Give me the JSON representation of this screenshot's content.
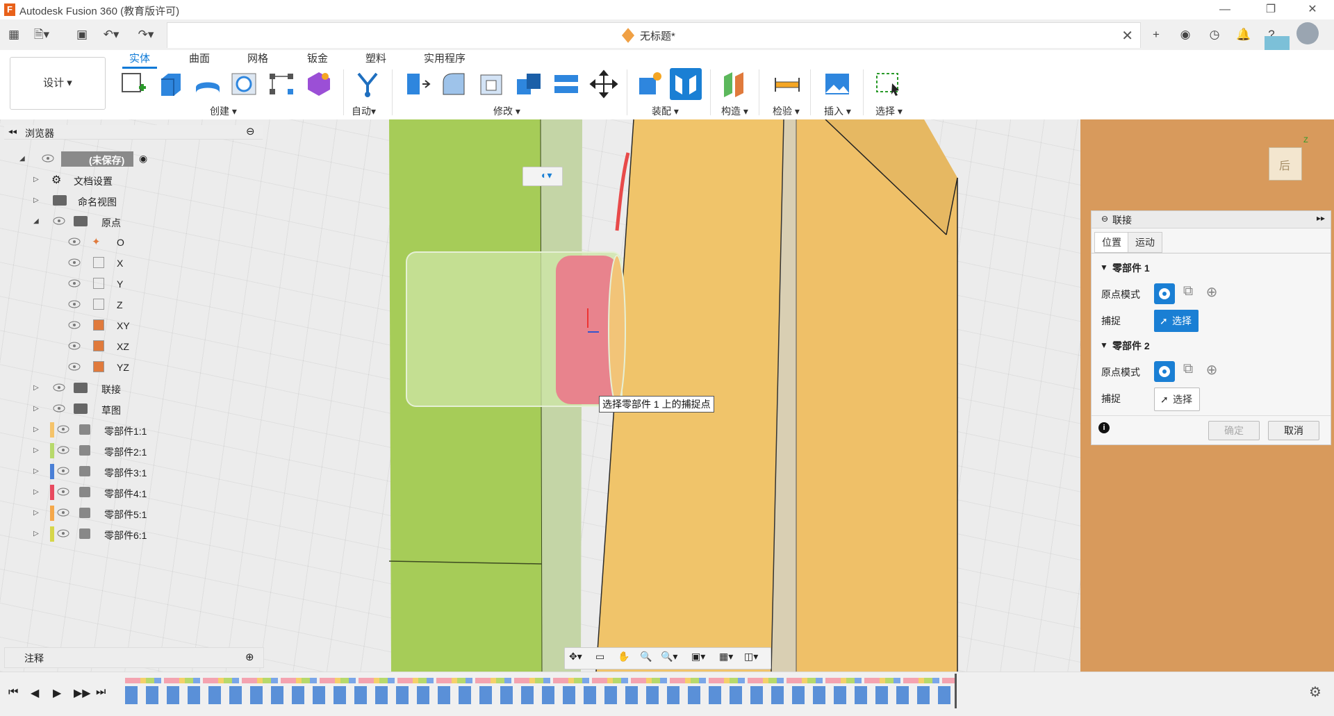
{
  "window": {
    "title": "Autodesk Fusion 360 (教育版许可)",
    "min": "—",
    "max": "❐",
    "close": "✕"
  },
  "document": {
    "name": "无标题*"
  },
  "ribbon": {
    "workspace": "设计 ▾",
    "tabs": [
      "实体",
      "曲面",
      "网格",
      "钣金",
      "塑料",
      "实用程序"
    ],
    "groups": [
      "创建 ▾",
      "自动▾",
      "修改 ▾",
      "装配 ▾",
      "构造 ▾",
      "检验 ▾",
      "插入 ▾",
      "选择 ▾"
    ]
  },
  "browser": {
    "title": "浏览器",
    "root": "(未保存)",
    "items": [
      "文档设置",
      "命名视图",
      "原点",
      "联接",
      "草图"
    ],
    "origin_items": [
      "O",
      "X",
      "Y",
      "Z",
      "XY",
      "XZ",
      "YZ"
    ],
    "components": [
      {
        "label": "零部件1:1",
        "color": "#f5c36a"
      },
      {
        "label": "零部件2:1",
        "color": "#b7d96b"
      },
      {
        "label": "零部件3:1",
        "color": "#4a7fd6"
      },
      {
        "label": "零部件4:1",
        "color": "#e84a5f"
      },
      {
        "label": "零部件5:1",
        "color": "#f5a84a"
      },
      {
        "label": "零部件6:1",
        "color": "#d6d64a"
      }
    ]
  },
  "notes": {
    "title": "注释"
  },
  "tooltip": "选择零部件 1 上的捕捉点",
  "viewcube": {
    "face": "后"
  },
  "joint": {
    "title": "联接",
    "tabs": [
      "位置",
      "运动"
    ],
    "section1": "零部件 1",
    "section2": "零部件 2",
    "origin_mode": "原点模式",
    "snap": "捕捉",
    "select": "选择",
    "ok": "确定",
    "cancel": "取消"
  },
  "colors": {
    "accent": "#0c79d6",
    "green_part": "#a6cc58",
    "yellow_part": "#f0c46a",
    "red_part": "#e8838d",
    "orange_bg": "#d89a5c"
  }
}
